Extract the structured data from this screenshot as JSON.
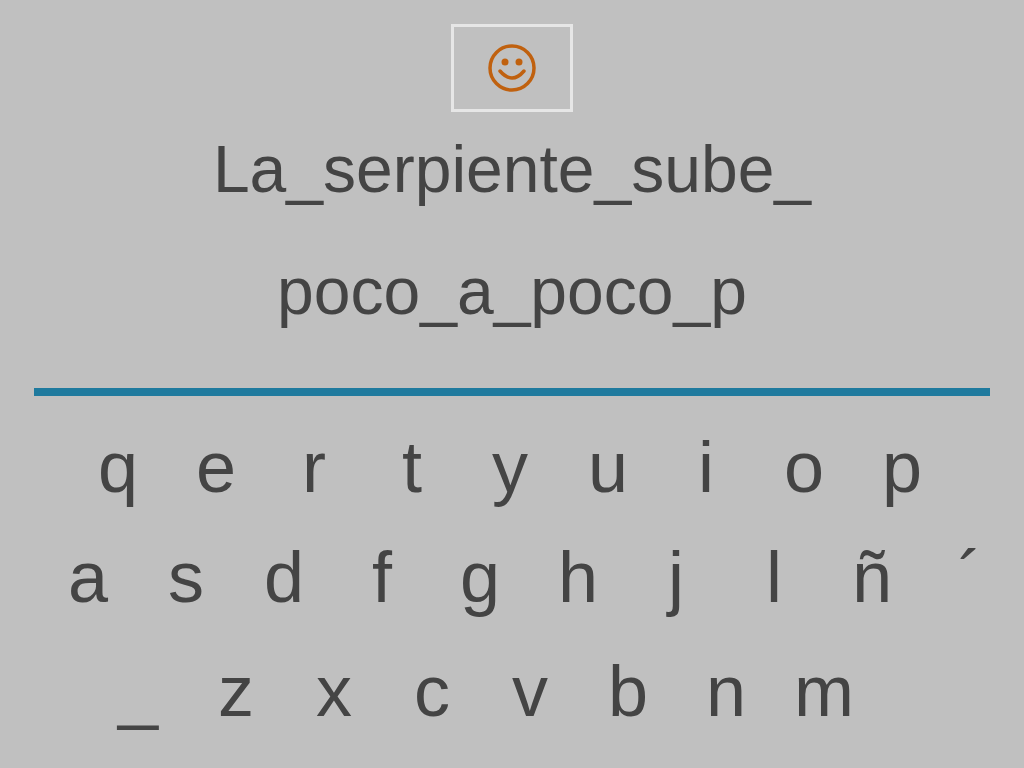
{
  "phrase_lines": [
    "La_serpiente_sube_",
    "poco_a_poco_p"
  ],
  "keyboard_rows": [
    [
      "q",
      "e",
      "r",
      "t",
      "y",
      "u",
      "i",
      "o",
      "p"
    ],
    [
      "a",
      "s",
      "d",
      "f",
      "g",
      "h",
      "j",
      "l",
      "ñ",
      "´"
    ],
    [
      "_",
      "z",
      "x",
      "c",
      "v",
      "b",
      "n",
      "m"
    ]
  ]
}
